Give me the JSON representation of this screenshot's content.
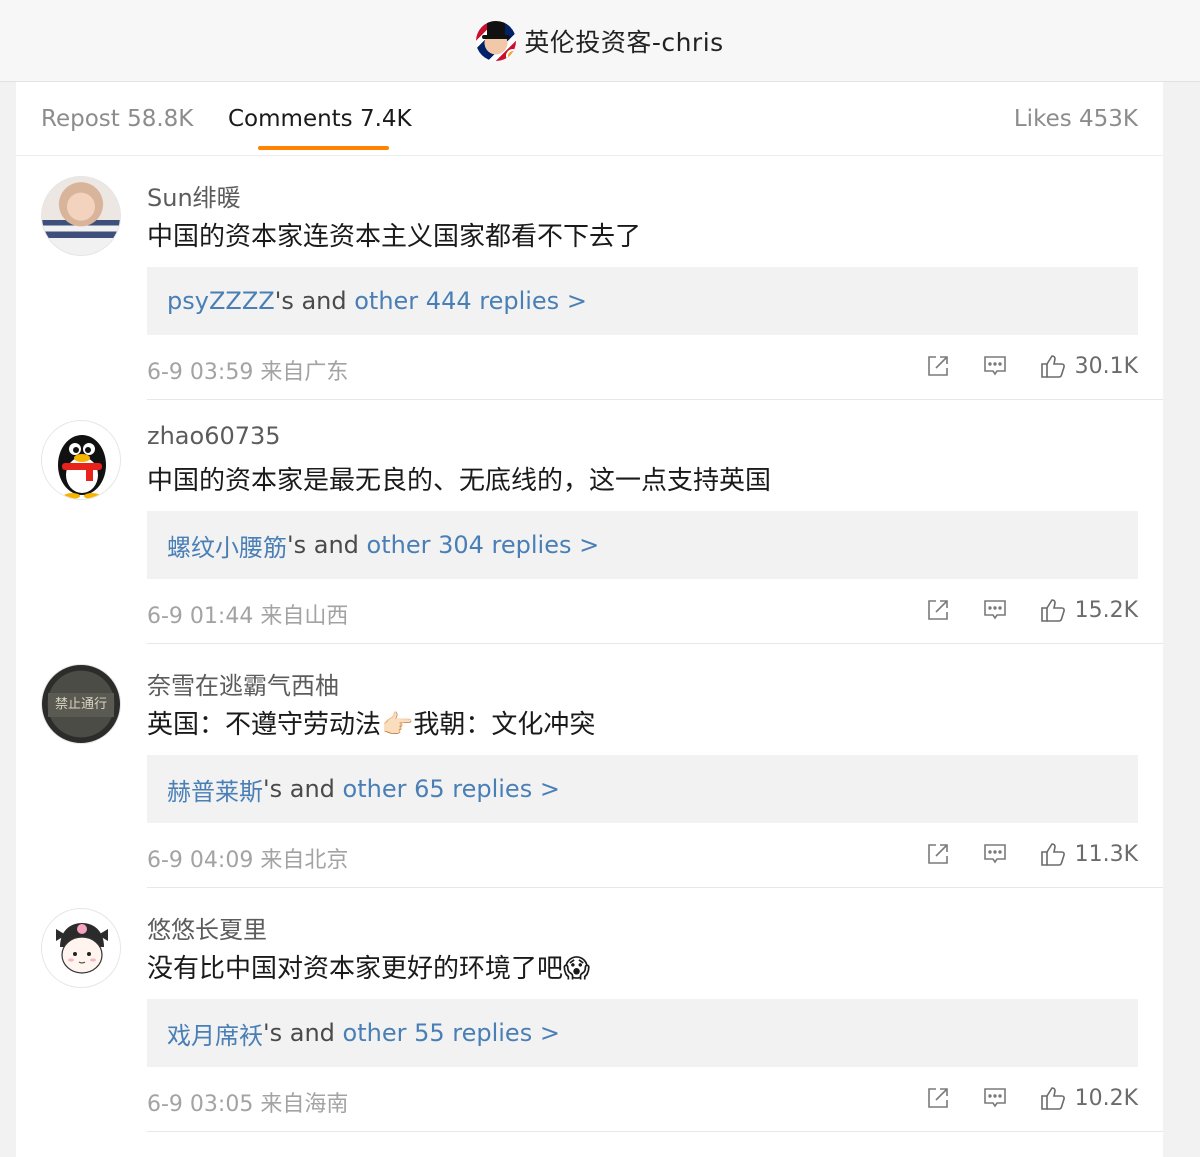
{
  "header": {
    "title": "英伦投资客-chris"
  },
  "tabs": {
    "repost": "Repost 58.8K",
    "comments": "Comments 7.4K",
    "likes": "Likes 453K"
  },
  "comments": [
    {
      "name": "Sun绯暖",
      "text": "中国的资本家连资本主义国家都看不下去了",
      "reply_user": "psyZZZZ",
      "reply_mid": "'s and ",
      "reply_other": "other 444 replies >",
      "meta": "6-9 03:59 来自广东",
      "likes": "30.1K"
    },
    {
      "name": "zhao60735",
      "text": "中国的资本家是最无良的、无底线的，这一点支持英国",
      "reply_user": "螺纹小腰筋",
      "reply_mid": "'s and ",
      "reply_other": "other 304 replies >",
      "meta": "6-9 01:44 来自山西",
      "likes": "15.2K"
    },
    {
      "name": "奈雪在逃霸气西柚",
      "text": "英国：不遵守劳动法👉🏻我朝：文化冲突",
      "reply_user": "赫普莱斯",
      "reply_mid": "'s and ",
      "reply_other": "other 65 replies >",
      "meta": "6-9 04:09 来自北京",
      "likes": "11.3K",
      "avatar_sign": "禁止通行"
    },
    {
      "name": "悠悠长夏里",
      "text": "没有比中国对资本家更好的环境了吧😱",
      "reply_user": "戏月席袄",
      "reply_mid": "'s and ",
      "reply_other": "other 55 replies >",
      "meta": "6-9 03:05 来自海南",
      "likes": "10.2K"
    }
  ],
  "icons": {
    "share": "share-icon",
    "comment": "comment-icon",
    "like": "thumbs-up-icon"
  },
  "colors": {
    "accent": "#ff8200",
    "link": "#4a7fb6",
    "verified": "#f5a623"
  }
}
